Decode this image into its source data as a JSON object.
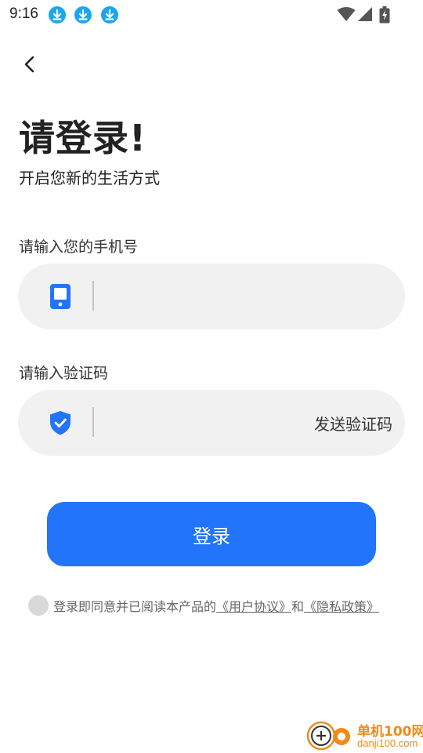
{
  "status_bar": {
    "time": "9:16",
    "notifications": [
      "download-icon",
      "download-icon",
      "download-icon"
    ],
    "system_icons": [
      "wifi-icon",
      "signal-icon",
      "battery-charging-icon"
    ]
  },
  "header": {
    "back_icon": "chevron-left-icon",
    "title": "请登录!",
    "subtitle": "开启您新的生活方式"
  },
  "phone_field": {
    "label": "请输入您的手机号",
    "icon": "phone-icon",
    "value": ""
  },
  "code_field": {
    "label": "请输入验证码",
    "icon": "shield-check-icon",
    "value": "",
    "send_code_label": "发送验证码"
  },
  "login_button": {
    "label": "登录"
  },
  "agreement": {
    "checked": false,
    "prefix": "登录即同意并已阅读本产品的",
    "user_agreement": "《用户协议》",
    "conjunction": "和",
    "privacy_policy": "《隐私政策》"
  },
  "watermark": {
    "name": "单机100网",
    "domain": "danji100.com"
  },
  "colors": {
    "accent": "#2274fb",
    "input_bg": "#f1f1f1",
    "notification_icon": "#19a7f0",
    "watermark": "#f08a1a"
  }
}
